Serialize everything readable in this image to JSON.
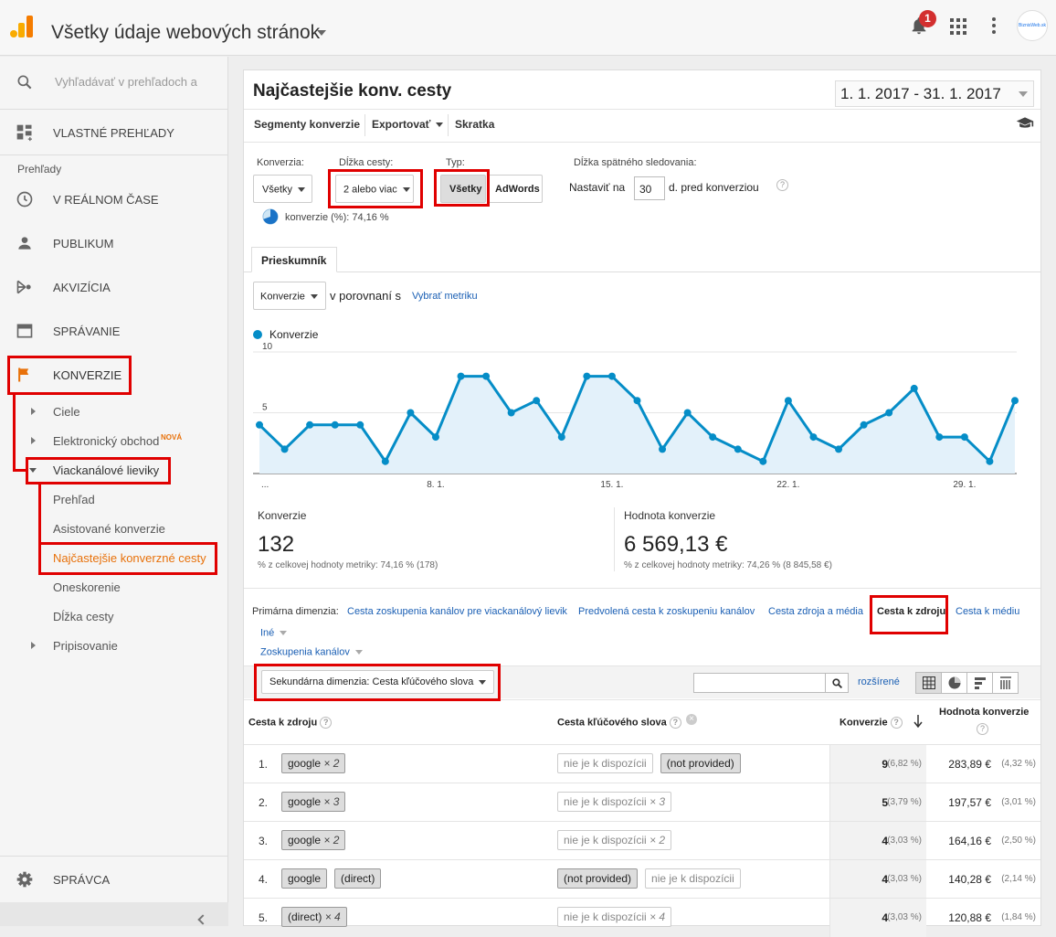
{
  "header": {
    "account_title": "Všetky údaje webových stránok",
    "notif_count": "1",
    "avatar_text": "BiznisWeb.sk"
  },
  "sidebar": {
    "search_placeholder": "Vyhľadávať v prehľadoch a",
    "custom_reports": "VLASTNÉ PREHĽADY",
    "reports_heading": "Prehľady",
    "realtime": "V REÁLNOM ČASE",
    "audience": "PUBLIKUM",
    "acquisition": "AKVIZÍCIA",
    "behavior": "SPRÁVANIE",
    "conversions": "KONVERZIE",
    "goals": "Ciele",
    "ecommerce": "Elektronický obchod",
    "ecommerce_badge": "NOVÁ",
    "mcf": "Viackanálové lieviky",
    "overview": "Prehľad",
    "assisted": "Asistované konverzie",
    "top_paths": "Najčastejšie konverzné cesty",
    "time_lag": "Oneskorenie",
    "path_length": "Dĺžka cesty",
    "attribution": "Pripisovanie",
    "admin": "SPRÁVCA"
  },
  "report": {
    "title": "Najčastejšie konv. cesty",
    "date_range": "1. 1. 2017 - 31. 1. 2017",
    "toolbar": {
      "segments": "Segmenty konverzie",
      "export": "Exportovať",
      "shortcut": "Skratka"
    },
    "filters": {
      "conversion_label": "Konverzia:",
      "conversion_value": "Všetky",
      "path_length_label": "Dĺžka cesty:",
      "path_length_value": "2 alebo viac",
      "type_label": "Typ:",
      "type_all": "Všetky",
      "type_adwords": "AdWords",
      "lookback_label": "Dĺžka spätného sledovania:",
      "lookback_prefix": "Nastaviť na",
      "lookback_value": "30",
      "lookback_suffix": "d. pred konverziou",
      "pie_text": "konverzie (%): 74,16 %"
    },
    "explorer_tab": "Prieskumník",
    "metric_select": "Konverzie",
    "compare_text": "v porovnaní s",
    "choose_metric": "Vybrať metriku",
    "legend": "Konverzie"
  },
  "chart_data": {
    "type": "area",
    "series": [
      {
        "name": "Konverzie",
        "values": [
          4,
          2,
          4,
          4,
          4,
          1,
          5,
          3,
          8,
          8,
          5,
          6,
          3,
          8,
          8,
          6,
          2,
          5,
          3,
          2,
          1,
          6,
          3,
          2,
          4,
          5,
          7,
          3,
          3,
          1,
          6
        ]
      }
    ],
    "x": [
      "1. 1.",
      "2. 1.",
      "3. 1.",
      "4. 1.",
      "5. 1.",
      "6. 1.",
      "7. 1.",
      "8. 1.",
      "9. 1.",
      "10. 1.",
      "11. 1.",
      "12. 1.",
      "13. 1.",
      "14. 1.",
      "15. 1.",
      "16. 1.",
      "17. 1.",
      "18. 1.",
      "19. 1.",
      "20. 1.",
      "21. 1.",
      "22. 1.",
      "23. 1.",
      "24. 1.",
      "25. 1.",
      "26. 1.",
      "27. 1.",
      "28. 1.",
      "29. 1.",
      "30. 1.",
      "31. 1."
    ],
    "xtick_labels": [
      "...",
      "8. 1.",
      "15. 1.",
      "22. 1.",
      "29. 1."
    ],
    "ytick_labels": [
      "10",
      "5"
    ],
    "ylim": [
      0,
      10
    ],
    "color": "#058dc7"
  },
  "scorecards": [
    {
      "label": "Konverzie",
      "value": "132",
      "sub": "% z celkovej hodnoty metriky: 74,16 % (178)"
    },
    {
      "label": "Hodnota konverzie",
      "value": "6 569,13 €",
      "sub": "% z celkovej hodnoty metriky: 74,26 % (8 845,58 €)"
    }
  ],
  "dimensions": {
    "label": "Primárna dimenzia:",
    "items": [
      "Cesta zoskupenia kanálov pre viackanálový lievik",
      "Predvolená cesta k zoskupeniu kanálov",
      "Cesta zdroja a média",
      "Cesta k zdroju",
      "Cesta k médiu"
    ],
    "other": "Iné",
    "channel_groupings": "Zoskupenia kanálov",
    "secondary": "Sekundárna dimenzia: Cesta kľúčového slova",
    "advanced": "rozšírené"
  },
  "table": {
    "headers": {
      "source_path": "Cesta k zdroju",
      "keyword_path": "Cesta kľúčového slova",
      "conversions": "Konverzie",
      "value": "Hodnota konverzie"
    },
    "rows": [
      {
        "rank": "1.",
        "source": [
          {
            "t": "google",
            "m": "× 2"
          }
        ],
        "keyword": [
          {
            "t": "nie je k dispozícii",
            "m": "",
            "na": true
          },
          {
            "t": "(not provided)",
            "m": "",
            "na": false
          }
        ],
        "conv": "9",
        "conv_pct": "(6,82 %)",
        "val": "283,89 €",
        "val_pct": "(4,32 %)"
      },
      {
        "rank": "2.",
        "source": [
          {
            "t": "google",
            "m": "× 3"
          }
        ],
        "keyword": [
          {
            "t": "nie je k dispozícii",
            "m": "× 3",
            "na": true
          }
        ],
        "conv": "5",
        "conv_pct": "(3,79 %)",
        "val": "197,57 €",
        "val_pct": "(3,01 %)"
      },
      {
        "rank": "3.",
        "source": [
          {
            "t": "google",
            "m": "× 2"
          }
        ],
        "keyword": [
          {
            "t": "nie je k dispozícii",
            "m": "× 2",
            "na": true
          }
        ],
        "conv": "4",
        "conv_pct": "(3,03 %)",
        "val": "164,16 €",
        "val_pct": "(2,50 %)"
      },
      {
        "rank": "4.",
        "source": [
          {
            "t": "google",
            "m": ""
          },
          {
            "t": "(direct)",
            "m": ""
          }
        ],
        "keyword": [
          {
            "t": "(not provided)",
            "m": "",
            "na": false
          },
          {
            "t": "nie je k dispozícii",
            "m": "",
            "na": true
          }
        ],
        "conv": "4",
        "conv_pct": "(3,03 %)",
        "val": "140,28 €",
        "val_pct": "(2,14 %)"
      },
      {
        "rank": "5.",
        "source": [
          {
            "t": "(direct)",
            "m": "× 4"
          }
        ],
        "keyword": [
          {
            "t": "nie je k dispozícii",
            "m": "× 4",
            "na": true
          }
        ],
        "conv": "4",
        "conv_pct": "(3,03 %)",
        "val": "120,88 €",
        "val_pct": "(1,84 %)"
      }
    ]
  },
  "colors": {
    "accent": "#e8710a",
    "link": "#1a5fb4",
    "highlight_box": "#e00000",
    "chart": "#058dc7"
  }
}
